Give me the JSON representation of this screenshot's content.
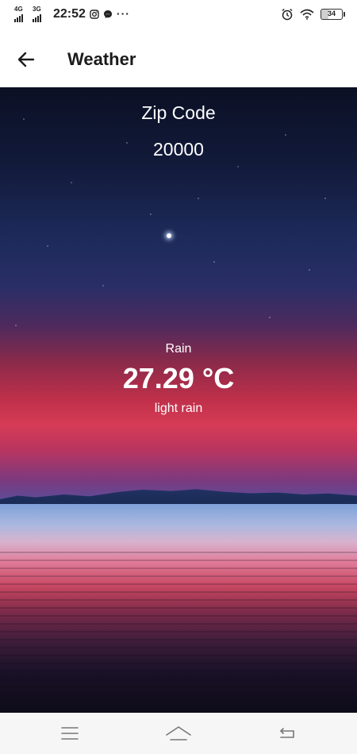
{
  "status_bar": {
    "network_1": "4G",
    "network_2": "3G",
    "time": "22:52",
    "more": "···",
    "battery": "34",
    "icons": [
      "signal-icon",
      "instagram-icon",
      "messenger-icon",
      "alarm-icon",
      "wifi-icon",
      "battery-icon"
    ]
  },
  "app_bar": {
    "title": "Weather",
    "back_icon": "back-arrow-icon"
  },
  "weather": {
    "zip_label": "Zip Code",
    "zip_value": "20000",
    "main": "Rain",
    "temperature": "27.29 °C",
    "description": "light rain"
  },
  "nav_bar": {
    "icons": [
      "menu-icon",
      "home-icon",
      "back-icon"
    ]
  },
  "colors": {
    "app_bar_bg": "#ffffff",
    "title_text": "#1b1b1b",
    "overlay_text": "#ffffff",
    "nav_bar_bg": "#f6f6f6"
  }
}
